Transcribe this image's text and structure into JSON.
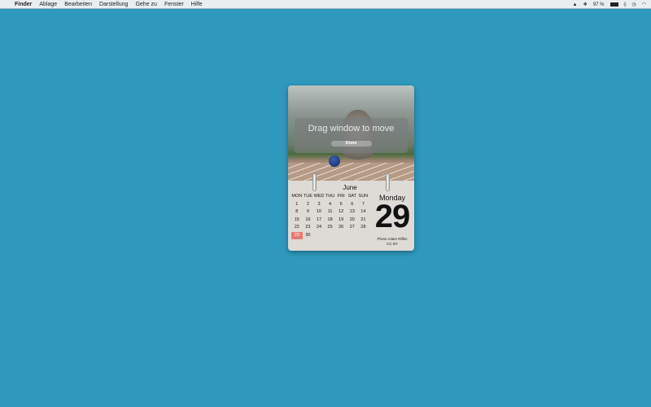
{
  "menubar": {
    "apple": "",
    "items": [
      "Finder",
      "Ablage",
      "Bearbeiten",
      "Darstellung",
      "Gehe zu",
      "Fenster",
      "Hilfe"
    ],
    "battery": "97 %"
  },
  "widget": {
    "overlay_text": "Drag window to move",
    "done_label": "Done",
    "month": "June",
    "weekdays": [
      "MON",
      "TUE",
      "WED",
      "THU",
      "FRI",
      "SAT",
      "SUN"
    ],
    "weeks": [
      [
        "1",
        "2",
        "3",
        "4",
        "5",
        "6",
        "7"
      ],
      [
        "8",
        "9",
        "10",
        "11",
        "12",
        "13",
        "14"
      ],
      [
        "15",
        "16",
        "17",
        "18",
        "19",
        "20",
        "21"
      ],
      [
        "22",
        "23",
        "24",
        "25",
        "26",
        "27",
        "28"
      ],
      [
        "29",
        "30",
        "",
        "",
        "",
        "",
        ""
      ]
    ],
    "today": "29",
    "day_name": "Monday",
    "day_number": "29",
    "credit_line1": "Photo Adam Rifkin",
    "credit_line2": "CC BY",
    "today_color": "#e97a72"
  }
}
